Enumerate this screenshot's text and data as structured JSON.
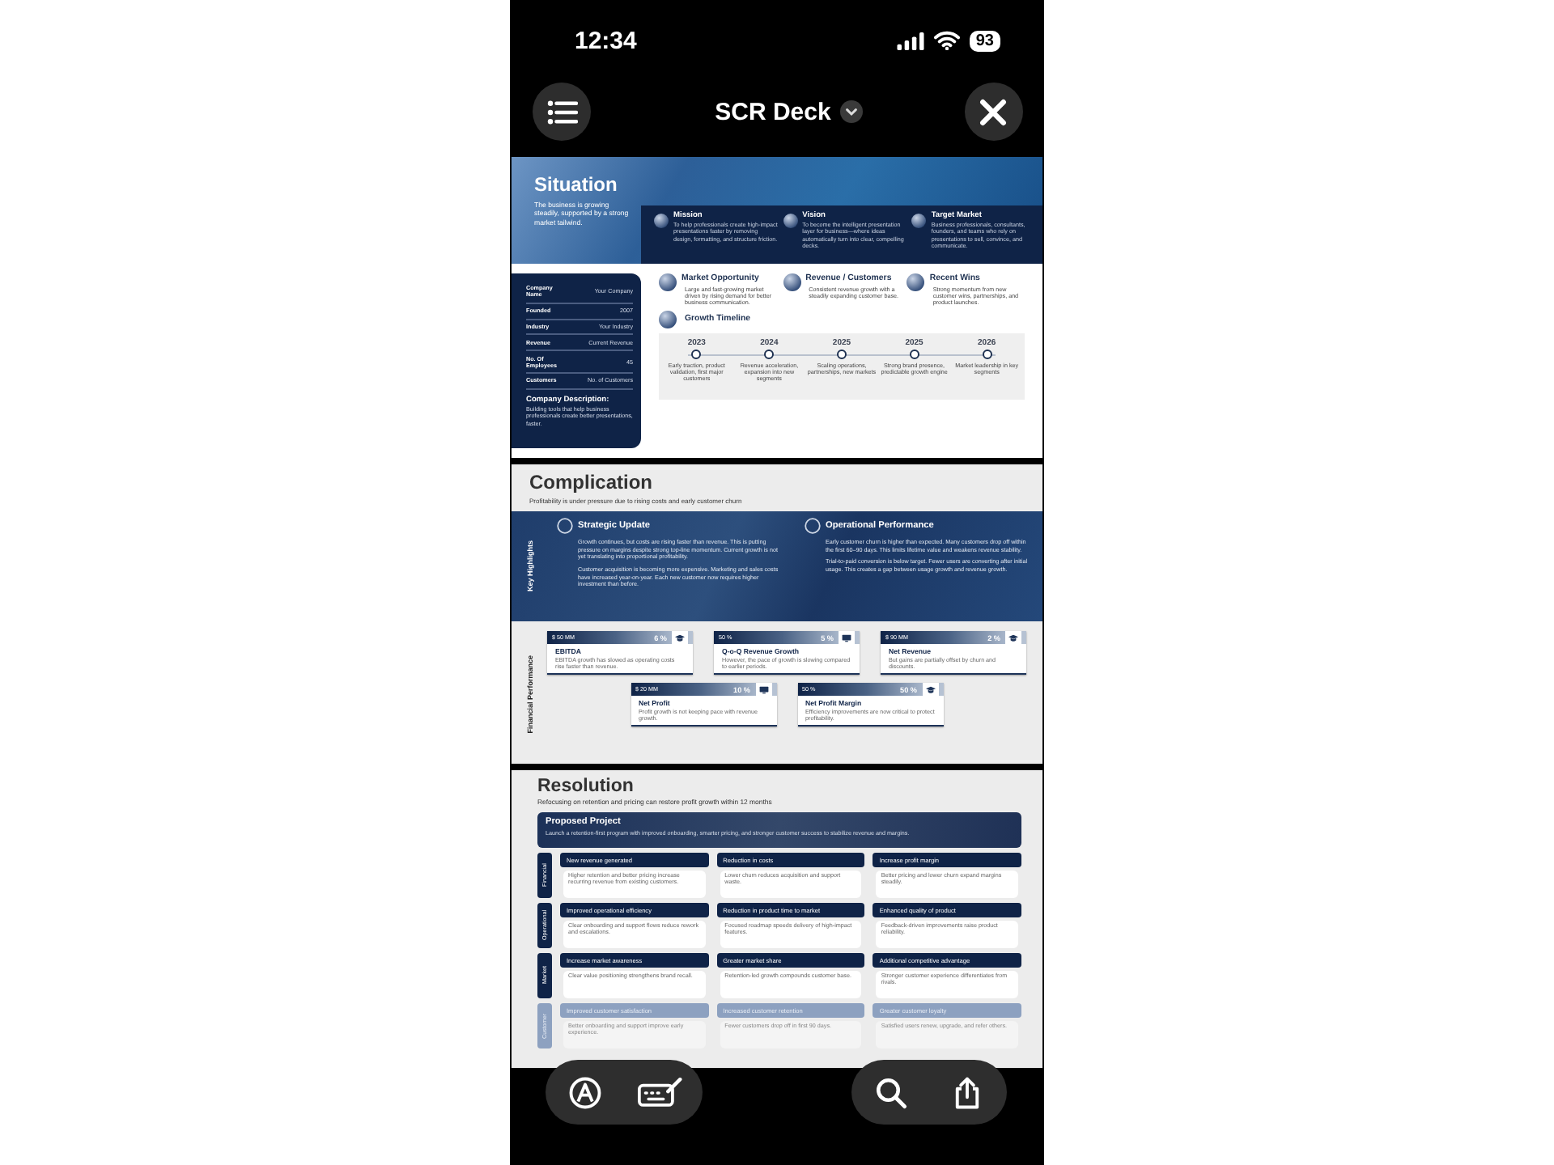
{
  "status_bar": {
    "time": "12:34",
    "battery": "93"
  },
  "header": {
    "title": "SCR Deck"
  },
  "slides": [
    {
      "kind": "situation",
      "title": "Situation",
      "subtitle": "The business is growing steadily, supported by a strong market tailwind.",
      "pillars": [
        {
          "title": "Mission",
          "text": "To help professionals create high-impact presentations faster by removing design, formatting, and structure friction."
        },
        {
          "title": "Vision",
          "text": "To become the intelligent presentation layer for business—where ideas automatically turn into clear, compelling decks."
        },
        {
          "title": "Target Market",
          "text": "Business professionals, consultants, founders, and teams who rely on presentations to sell, convince, and communicate."
        }
      ],
      "company": {
        "rows": [
          {
            "label": "Company Name",
            "value": "Your Company"
          },
          {
            "label": "Founded",
            "value": "2007"
          },
          {
            "label": "Industry",
            "value": "Your Industry"
          },
          {
            "label": "Revenue",
            "value": "Current Revenue"
          },
          {
            "label": "No. Of Employees",
            "value": "45"
          },
          {
            "label": "Customers",
            "value": "No. of Customers"
          }
        ],
        "description_title": "Company Description:",
        "description": "Building tools that help business professionals create better presentations, faster."
      },
      "highlights": [
        {
          "title": "Market Opportunity",
          "text": "Large and fast-growing market driven by rising demand for better business communication."
        },
        {
          "title": "Revenue / Customers",
          "text": "Consistent revenue growth with a steadily expanding customer base."
        },
        {
          "title": "Recent Wins",
          "text": "Strong momentum from new customer wins, partnerships, and product launches."
        }
      ],
      "timeline": {
        "title": "Growth Timeline",
        "steps": [
          {
            "year": "2023",
            "text": "Early traction, product validation, first major customers"
          },
          {
            "year": "2024",
            "text": "Revenue acceleration, expansion into new segments"
          },
          {
            "year": "2025",
            "text": "Scaling operations, partnerships, new markets"
          },
          {
            "year": "2025",
            "text": "Strong brand presence, predictable growth engine"
          },
          {
            "year": "2026",
            "text": "Market leadership in key segments"
          }
        ]
      }
    },
    {
      "kind": "complication",
      "title": "Complication",
      "subtitle": "Profitability is under pressure due to rising costs and early customer churn",
      "highlights_label": "Key Highlights",
      "updates": [
        {
          "title": "Strategic Update",
          "paragraphs": [
            "Growth continues, but costs are rising faster than revenue. This is putting pressure on margins despite strong top-line momentum. Current growth is not yet translating into proportional profitability.",
            "Customer acquisition is becoming more expensive. Marketing and sales costs have increased year-on-year. Each new customer now requires higher investment than before."
          ]
        },
        {
          "title": "Operational Performance",
          "paragraphs": [
            "Early customer churn is higher than expected. Many customers drop off within the first 60–90 days. This limits lifetime value and weakens revenue stability.",
            "Trial-to-paid conversion is below target. Fewer users are converting after initial usage. This creates a gap between usage growth and revenue growth."
          ]
        }
      ],
      "financial_label": "Financial Performance",
      "metric_rows": [
        [
          {
            "amount": "$ 50 MM",
            "change": "6 %",
            "title": "EBITDA",
            "text": "EBITDA growth has slowed as operating costs rise faster than revenue."
          },
          {
            "amount": "50 %",
            "change": "5 %",
            "title": "Q-o-Q Revenue Growth",
            "text": "However, the pace of growth is slowing compared to earlier periods."
          },
          {
            "amount": "$ 90 MM",
            "change": "2 %",
            "title": "Net Revenue",
            "text": "But gains are partially offset by churn and discounts."
          }
        ],
        [
          {
            "amount": "$ 20 MM",
            "change": "10 %",
            "title": "Net Profit",
            "text": "Profit growth is not keeping pace with revenue growth."
          },
          {
            "amount": "50 %",
            "change": "50 %",
            "title": "Net Profit Margin",
            "text": "Efficiency improvements are now critical to protect profitability."
          }
        ]
      ]
    },
    {
      "kind": "resolution",
      "title": "Resolution",
      "subtitle": "Refocusing on retention and pricing can restore profit growth within 12 months",
      "project": {
        "title": "Proposed Project",
        "text": "Launch a retention-first program with improved onboarding, smarter pricing, and stronger customer success to stabilize revenue and margins."
      },
      "rows": [
        {
          "label": "Financial",
          "faded": false,
          "cells": [
            {
              "title": "New revenue generated",
              "text": "Higher retention and better pricing increase recurring revenue from existing customers."
            },
            {
              "title": "Reduction in costs",
              "text": "Lower churn reduces acquisition and support waste."
            },
            {
              "title": "Increase profit margin",
              "text": "Better pricing and lower churn expand margins steadily."
            }
          ]
        },
        {
          "label": "Operational",
          "faded": false,
          "cells": [
            {
              "title": "Improved operational efficiency",
              "text": "Clear onboarding and support flows reduce rework and escalations."
            },
            {
              "title": "Reduction in product time to market",
              "text": "Focused roadmap speeds delivery of high-impact features."
            },
            {
              "title": "Enhanced quality of product",
              "text": "Feedback-driven improvements raise product reliability."
            }
          ]
        },
        {
          "label": "Market",
          "faded": false,
          "cells": [
            {
              "title": "Increase market awareness",
              "text": "Clear value positioning strengthens brand recall."
            },
            {
              "title": "Greater market share",
              "text": "Retention-led growth compounds customer base."
            },
            {
              "title": "Additional competitive advantage",
              "text": "Stronger customer experience differentiates from rivals."
            }
          ]
        },
        {
          "label": "Customer",
          "faded": true,
          "cells": [
            {
              "title": "Improved customer satisfaction",
              "text": "Better onboarding and support improve early experience."
            },
            {
              "title": "Increased customer retention",
              "text": "Fewer customers drop off in first 90 days."
            },
            {
              "title": "Greater customer loyalty",
              "text": "Satisfied users renew, upgrade, and refer others."
            }
          ]
        }
      ]
    }
  ]
}
